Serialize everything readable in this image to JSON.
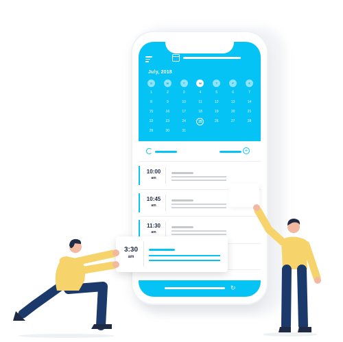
{
  "calendar": {
    "month_label": "July, 2018",
    "weekdays": [
      "S",
      "M",
      "T",
      "W",
      "T",
      "F",
      "S"
    ],
    "selected_weekday_index": 3,
    "weeks": [
      [
        "",
        "",
        "",
        "",
        "",
        "",
        ""
      ],
      [
        "1",
        "2",
        "3",
        "4",
        "5",
        "6",
        "7"
      ],
      [
        "8",
        "9",
        "10",
        "11",
        "12",
        "13",
        "14"
      ],
      [
        "15",
        "16",
        "17",
        "18",
        "19",
        "20",
        "21"
      ],
      [
        "22",
        "23",
        "24",
        "25",
        "26",
        "27",
        "28"
      ],
      [
        "29",
        "30",
        "31",
        "",
        "",
        "",
        ""
      ]
    ],
    "today": "25"
  },
  "events": [
    {
      "time": "10:00",
      "period": "am"
    },
    {
      "time": "10:45",
      "period": "am"
    },
    {
      "time": "11:30",
      "period": "am"
    }
  ],
  "popout_event": {
    "time": "3:30",
    "period": "am"
  },
  "icons": {
    "menu": "menu-icon",
    "calendar": "calendar-icon",
    "refresh": "refresh-icon",
    "add": "add-circle-icon",
    "sync": "sync-icon"
  },
  "colors": {
    "accent": "#05c3f5",
    "text_dark": "#1f2b44",
    "shirt": "#f6d36b",
    "pants": "#1b3a6b"
  }
}
